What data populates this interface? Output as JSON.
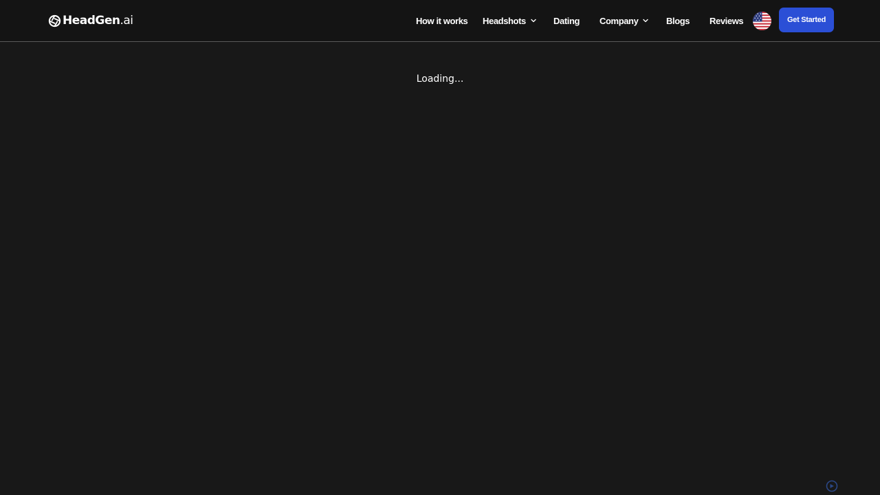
{
  "brand": {
    "name": "HeadGen",
    "suffix": ".ai",
    "logo_icon": "aperture-icon"
  },
  "nav": {
    "items": [
      {
        "label": "How it works",
        "has_dropdown": false
      },
      {
        "label": "Headshots",
        "has_dropdown": true
      },
      {
        "label": "Dating",
        "has_dropdown": false
      },
      {
        "label": "Company",
        "has_dropdown": true
      },
      {
        "label": "Blogs",
        "has_dropdown": false
      },
      {
        "label": "Reviews",
        "has_dropdown": false
      }
    ],
    "language_flag": "us-flag-icon",
    "cta_label": "Get Started"
  },
  "main": {
    "status_text": "Loading..."
  },
  "widget": {
    "icon": "chat-widget-icon"
  },
  "colors": {
    "background": "#181818",
    "navbar": "#141414",
    "accent": "#2b4fd6",
    "text": "#ffffff"
  }
}
